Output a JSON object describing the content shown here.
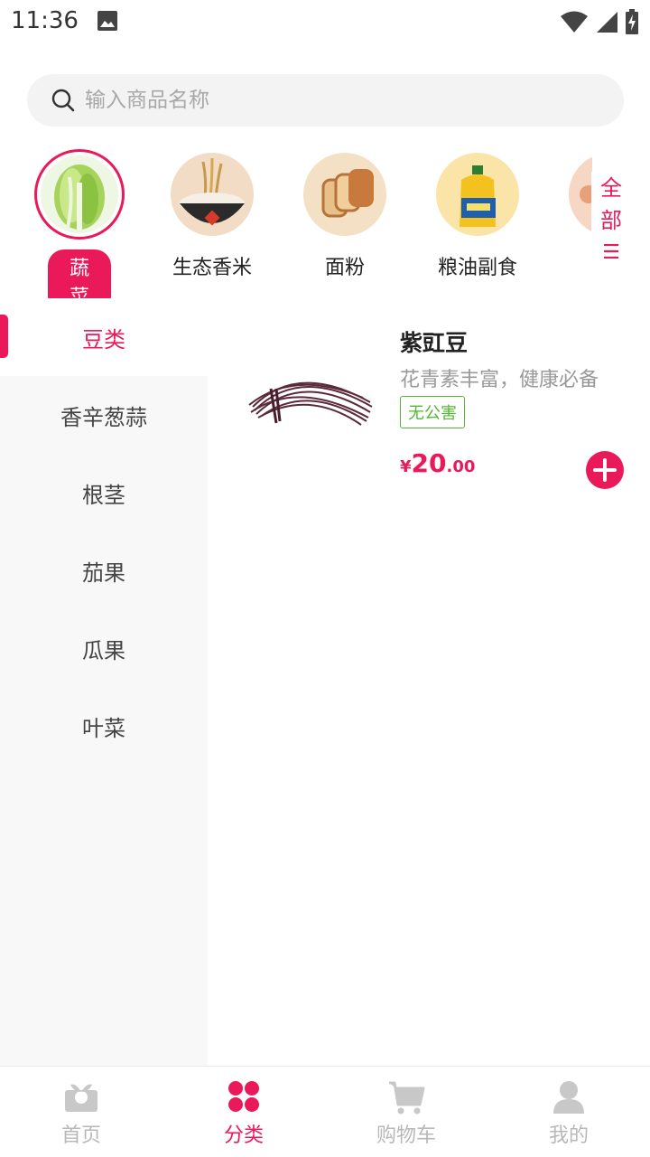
{
  "status_bar": {
    "time": "11:36"
  },
  "search": {
    "placeholder": "输入商品名称"
  },
  "top_categories": [
    {
      "label": "蔬菜",
      "active": true
    },
    {
      "label": "生态香米"
    },
    {
      "label": "面粉"
    },
    {
      "label": "粮油副食"
    }
  ],
  "all_button": {
    "chars": [
      "全",
      "部",
      "☰"
    ]
  },
  "sidebar": {
    "items": [
      {
        "label": "豆类",
        "active": true
      },
      {
        "label": "香辛葱蒜"
      },
      {
        "label": "根茎"
      },
      {
        "label": "茄果"
      },
      {
        "label": "瓜果"
      },
      {
        "label": "叶菜"
      }
    ]
  },
  "product": {
    "name": "紫豇豆",
    "description": "花青素丰富，健康必备",
    "tag": "无公害",
    "price_symbol": "¥",
    "price_integer": "20",
    "price_decimal": ".00"
  },
  "bottom_nav": [
    {
      "label": "首页",
      "icon": "home-icon"
    },
    {
      "label": "分类",
      "icon": "category-icon",
      "active": true
    },
    {
      "label": "购物车",
      "icon": "cart-icon"
    },
    {
      "label": "我的",
      "icon": "profile-icon"
    }
  ],
  "colors": {
    "accent": "#ea1a5a",
    "tag_green": "#52b830",
    "inactive": "#b8b8b8"
  }
}
